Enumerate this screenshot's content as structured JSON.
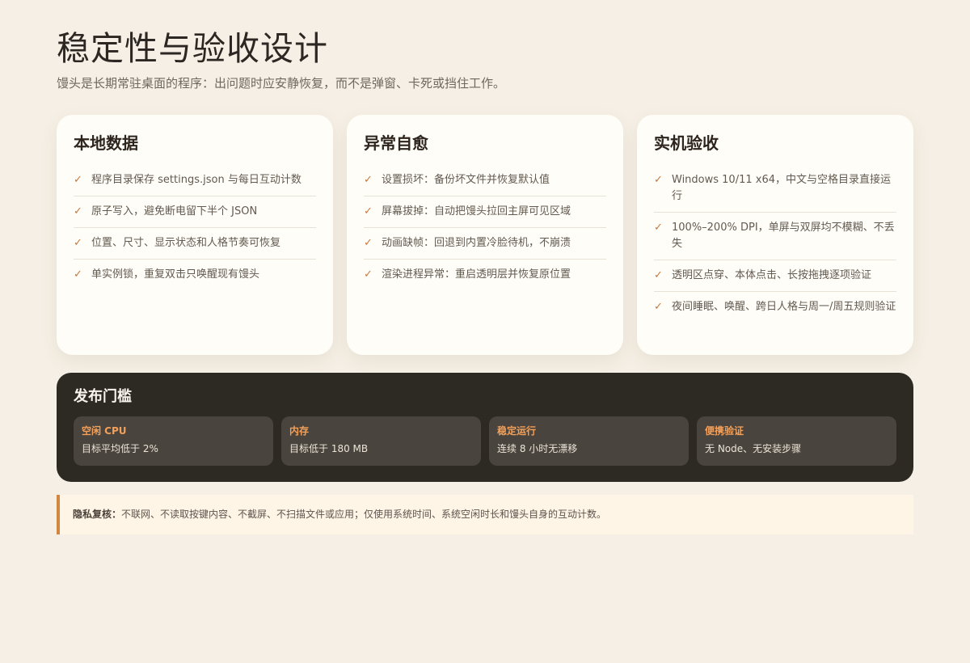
{
  "header": {
    "title": "稳定性与验收设计",
    "subtitle": "馒头是长期常驻桌面的程序：出问题时应安静恢复，而不是弹窗、卡死或挡住工作。"
  },
  "cards": [
    {
      "title": "本地数据",
      "items": [
        {
          "icon": "check-icon",
          "text": "程序目录保存 settings.json 与每日互动计数"
        },
        {
          "icon": "check-icon",
          "text": "原子写入，避免断电留下半个 JSON"
        },
        {
          "icon": "check-icon",
          "text": "位置、尺寸、显示状态和人格节奏可恢复"
        },
        {
          "icon": "check-icon",
          "text": "单实例锁，重复双击只唤醒现有馒头"
        }
      ]
    },
    {
      "title": "异常自愈",
      "items": [
        {
          "icon": "check-icon",
          "text": "设置损坏：备份坏文件并恢复默认值"
        },
        {
          "icon": "check-icon",
          "text": "屏幕拔掉：自动把馒头拉回主屏可见区域"
        },
        {
          "icon": "check-icon",
          "text": "动画缺帧：回退到内置冷脸待机，不崩溃"
        },
        {
          "icon": "check-icon",
          "text": "渲染进程异常：重启透明层并恢复原位置"
        }
      ]
    },
    {
      "title": "实机验收",
      "items": [
        {
          "icon": "check-icon",
          "text": "Windows 10/11 x64，中文与空格目录直接运行"
        },
        {
          "icon": "check-icon",
          "text": "100%–200% DPI，单屏与双屏均不模糊、不丢失"
        },
        {
          "icon": "check-icon",
          "text": "透明区点穿、本体点击、长按拖拽逐项验证"
        },
        {
          "icon": "check-icon",
          "text": "夜间睡眠、唤醒、跨日人格与周一/周五规则验证"
        }
      ]
    }
  ],
  "release": {
    "title": "发布门槛",
    "metrics": [
      {
        "label": "空闲 CPU",
        "value": "目标平均低于 2%"
      },
      {
        "label": "内存",
        "value": "目标低于 180 MB"
      },
      {
        "label": "稳定运行",
        "value": "连续 8 小时无漂移"
      },
      {
        "label": "便携验证",
        "value": "无 Node、无安装步骤"
      }
    ]
  },
  "privacy": {
    "label": "隐私复核：",
    "text": "不联网、不读取按键内容、不截屏、不扫描文件或应用；仅使用系统时间、系统空闲时长和馒头自身的互动计数。"
  },
  "colors": {
    "background": "#f5efe5",
    "card": "#fffdf7",
    "accent": "#c7783d",
    "release_panel": "#2d2a24",
    "metric_card": "#49443d",
    "metric_label": "#f3a05a",
    "privacy_background": "#fff5e7"
  }
}
